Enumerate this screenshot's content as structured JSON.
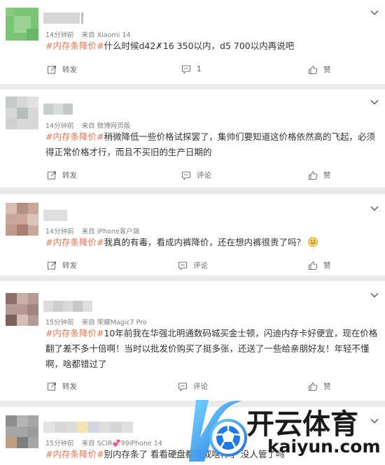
{
  "comments": [
    {
      "time": "14分钟前",
      "source": "来自 Xiaomi 14",
      "tag": "#内存条降价#",
      "body": "什么时候d42",
      "body_x": "✗",
      "body_rest": "16 350以内，d5 700以内再说吧",
      "repost_label": "转发",
      "comment_count": "1",
      "like_label": "赞"
    },
    {
      "time": "14分钟前",
      "source": "来自 微博网页版",
      "tag": "#内存条降价#",
      "body": "稍微降低一些价格试探罢了，集帅们要知道这价格依然高的飞起，必须得正常价格才行，而且不买旧的生产日期的",
      "repost_label": "转发",
      "comment_label": "评论",
      "like_label": "赞"
    },
    {
      "time": "14分钟前",
      "source": "来自 iPhone客户端",
      "tag": "#内存条降价#",
      "body": "我真的有毒，看成内裤降价，还在想内裤很贵了吗？",
      "emoji": "grin-emoji",
      "repost_label": "转发",
      "comment_label": "评论",
      "like_label": "赞"
    },
    {
      "time": "15分钟前",
      "source": "来自 荣耀Magic7 Pro",
      "tag": "#内存条降价#",
      "body": "10年前我在华强北明通数码城买金士顿，闪迪内存卡好便宜，现在价格翻了差不多十倍啊！当时以批发价购买了挺多张，还送了一些给亲朋好友！年轻不懂啊，啥都错过了",
      "repost_label": "转发",
      "comment_label": "评论",
      "like_label": "赞"
    },
    {
      "time": "15分钟前",
      "source": "来自 SCIR💞99iPhone 14",
      "tag": "#内存条降价#",
      "body": "别内存条了 看看硬盘都涨成啥样了 没人管了吗"
    }
  ],
  "watermark": {
    "brand": "开云体育",
    "url": "kaiyun.com"
  },
  "colors": {
    "tag": "#eb7350",
    "meta": "#808080",
    "background": "#ebebeb"
  },
  "icons": [
    "chevron-down-icon",
    "repost-icon",
    "comment-icon",
    "like-icon"
  ]
}
